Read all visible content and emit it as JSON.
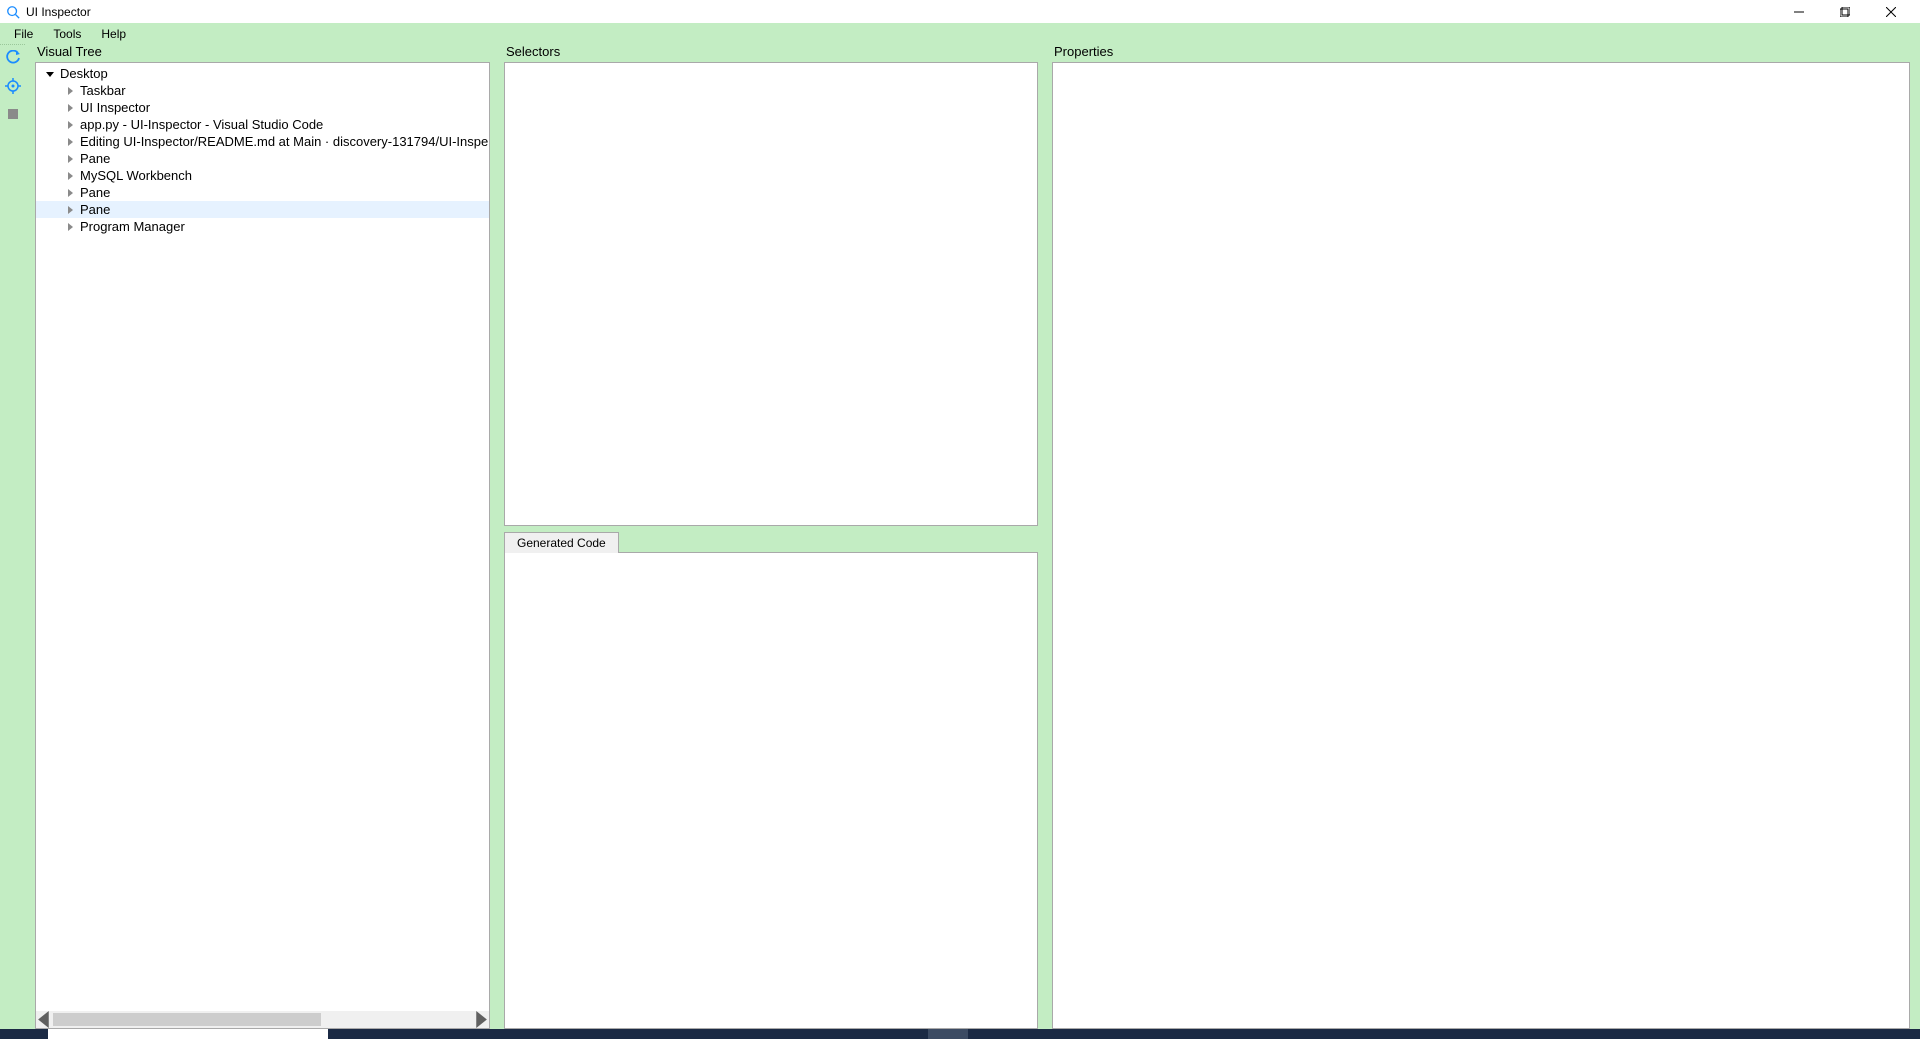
{
  "window": {
    "title": "UI Inspector"
  },
  "menu": {
    "file": "File",
    "tools": "Tools",
    "help": "Help"
  },
  "toolstrip": {
    "refresh": "refresh",
    "target": "target",
    "stop": "stop"
  },
  "panels": {
    "visual_tree_title": "Visual Tree",
    "selectors_title": "Selectors",
    "properties_title": "Properties",
    "generated_code_tab": "Generated Code"
  },
  "tree": {
    "root": "Desktop",
    "items": [
      {
        "label": "Taskbar",
        "selected": false
      },
      {
        "label": "UI Inspector",
        "selected": false
      },
      {
        "label": "app.py - UI-Inspector - Visual Studio Code",
        "selected": false
      },
      {
        "label": "Editing UI-Inspector/README.md at Main · discovery-131794/UI-Inspe",
        "selected": false
      },
      {
        "label": "Pane",
        "selected": false
      },
      {
        "label": "MySQL Workbench",
        "selected": false
      },
      {
        "label": "Pane",
        "selected": false
      },
      {
        "label": "Pane",
        "selected": true
      },
      {
        "label": "Program Manager",
        "selected": false
      }
    ]
  }
}
